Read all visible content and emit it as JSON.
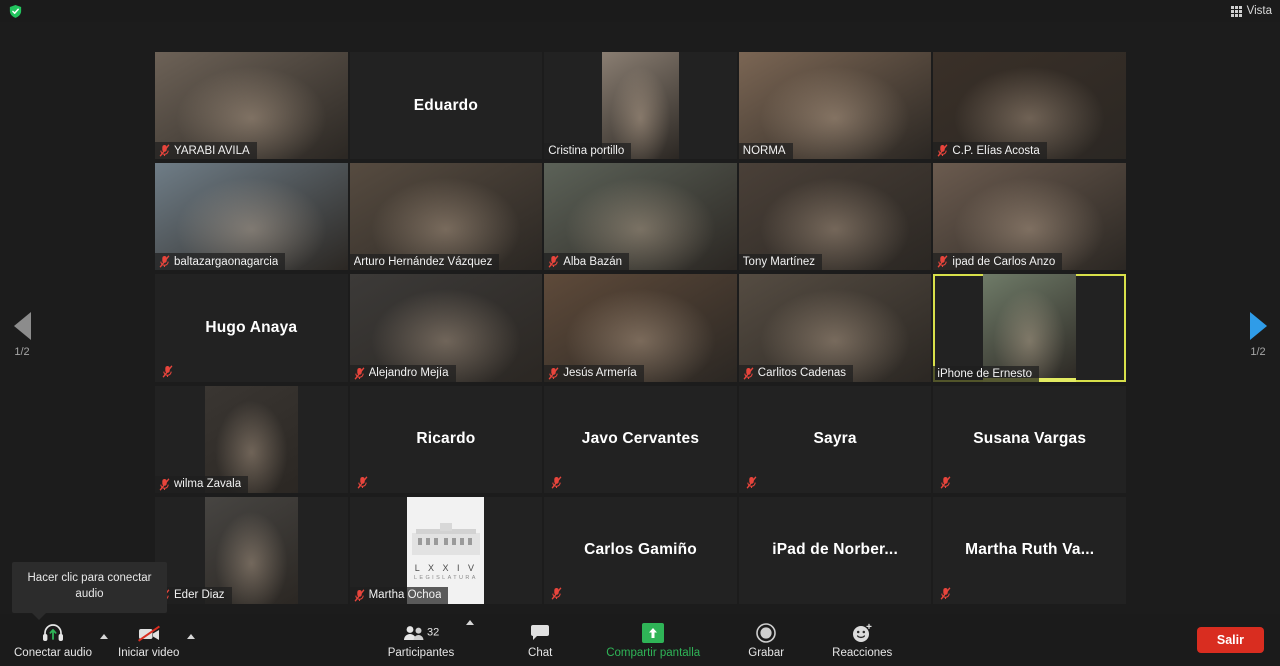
{
  "topbar": {
    "shield_icon": "shield-check-icon",
    "view_label": "Vista",
    "view_icon": "grid-icon"
  },
  "pager": {
    "left_label": "1/2",
    "right_label": "1/2",
    "left_icon": "chevron-left-icon",
    "right_icon": "chevron-right-icon"
  },
  "tooltip": {
    "text": "Hacer clic para conectar audio"
  },
  "gallery": {
    "participants": [
      {
        "name": "YARABI AVILA",
        "muted": true,
        "video": true,
        "speaking": false,
        "style": "wide",
        "bg": "#6d6257"
      },
      {
        "name": "Eduardo",
        "muted": false,
        "video": false,
        "speaking": false,
        "style": "none",
        "bg": "#222222"
      },
      {
        "name": "Cristina portillo",
        "muted": false,
        "video": true,
        "speaking": false,
        "style": "narrow",
        "bg": "#8a7e72"
      },
      {
        "name": "NORMA",
        "muted": false,
        "video": true,
        "speaking": false,
        "style": "wide",
        "bg": "#7b6654"
      },
      {
        "name": "C.P. Elías Acosta",
        "muted": true,
        "video": true,
        "speaking": false,
        "style": "wide",
        "bg": "#3a3028"
      },
      {
        "name": "baltazargaonagarcia",
        "muted": true,
        "video": true,
        "speaking": false,
        "style": "wide",
        "bg": "#6f7d87"
      },
      {
        "name": "Arturo Hernández Vázquez",
        "muted": false,
        "video": true,
        "speaking": true,
        "style": "wide",
        "bg": "#564b40"
      },
      {
        "name": "Alba Bazán",
        "muted": true,
        "video": true,
        "speaking": false,
        "style": "wide",
        "bg": "#5c6258"
      },
      {
        "name": "Tony Martínez",
        "muted": false,
        "video": true,
        "speaking": false,
        "style": "wide",
        "bg": "#4a4038"
      },
      {
        "name": "ipad de Carlos Anzo",
        "muted": true,
        "video": true,
        "speaking": false,
        "style": "wide",
        "bg": "#6b5b4f"
      },
      {
        "name": "Hugo Anaya",
        "muted": true,
        "video": false,
        "speaking": false,
        "style": "none",
        "bg": "#222222"
      },
      {
        "name": "Alejandro Mejía",
        "muted": true,
        "video": true,
        "speaking": false,
        "style": "wide",
        "bg": "#3c3a38"
      },
      {
        "name": "Jesús Armería",
        "muted": true,
        "video": true,
        "speaking": false,
        "style": "wide",
        "bg": "#5e4a3a"
      },
      {
        "name": "Carlitos Cadenas",
        "muted": true,
        "video": true,
        "speaking": false,
        "style": "wide",
        "bg": "#554c42"
      },
      {
        "name": "iPhone de Ernesto",
        "muted": false,
        "video": true,
        "speaking": true,
        "style": "portrait",
        "bg": "#6f7b68"
      },
      {
        "name": "wilma Zavala",
        "muted": true,
        "video": true,
        "speaking": false,
        "style": "portrait",
        "bg": "#3a3632"
      },
      {
        "name": "Ricardo",
        "muted": true,
        "video": false,
        "speaking": false,
        "style": "none",
        "bg": "#222222"
      },
      {
        "name": "Javo Cervantes",
        "muted": true,
        "video": false,
        "speaking": false,
        "style": "none",
        "bg": "#222222"
      },
      {
        "name": "Sayra",
        "muted": true,
        "video": false,
        "speaking": false,
        "style": "none",
        "bg": "#222222"
      },
      {
        "name": "Susana Vargas",
        "muted": true,
        "video": false,
        "speaking": false,
        "style": "none",
        "bg": "#222222"
      },
      {
        "name": "Eder Diaz",
        "muted": true,
        "video": true,
        "speaking": false,
        "style": "portrait",
        "bg": "#474542"
      },
      {
        "name": "Martha Ochoa",
        "muted": true,
        "video": true,
        "speaking": false,
        "style": "logo",
        "bg": "#f2f2f2"
      },
      {
        "name": "Carlos Gamiño",
        "muted": true,
        "video": false,
        "speaking": false,
        "style": "none",
        "bg": "#222222"
      },
      {
        "name": "iPad de  Norber...",
        "muted": false,
        "video": false,
        "speaking": false,
        "style": "none",
        "bg": "#222222"
      },
      {
        "name": "Martha Ruth Va...",
        "muted": true,
        "video": false,
        "speaking": false,
        "style": "none",
        "bg": "#222222"
      }
    ],
    "logo_tile": {
      "line1": "L X X I V",
      "line2": "LEGISLATURA"
    }
  },
  "toolbar": {
    "audio": {
      "label": "Conectar audio",
      "icon": "headset-icon"
    },
    "video": {
      "label": "Iniciar video",
      "icon": "camera-off-icon"
    },
    "participants": {
      "label": "Participantes",
      "count": "32",
      "icon": "people-icon"
    },
    "chat": {
      "label": "Chat",
      "icon": "chat-bubble-icon"
    },
    "share": {
      "label": "Compartir pantalla",
      "icon": "share-screen-icon",
      "color": "#2fb457"
    },
    "record": {
      "label": "Grabar",
      "icon": "record-circle-icon"
    },
    "reactions": {
      "label": "Reacciones",
      "icon": "smiley-icon"
    },
    "leave": {
      "label": "Salir",
      "color": "#d92d20"
    }
  }
}
